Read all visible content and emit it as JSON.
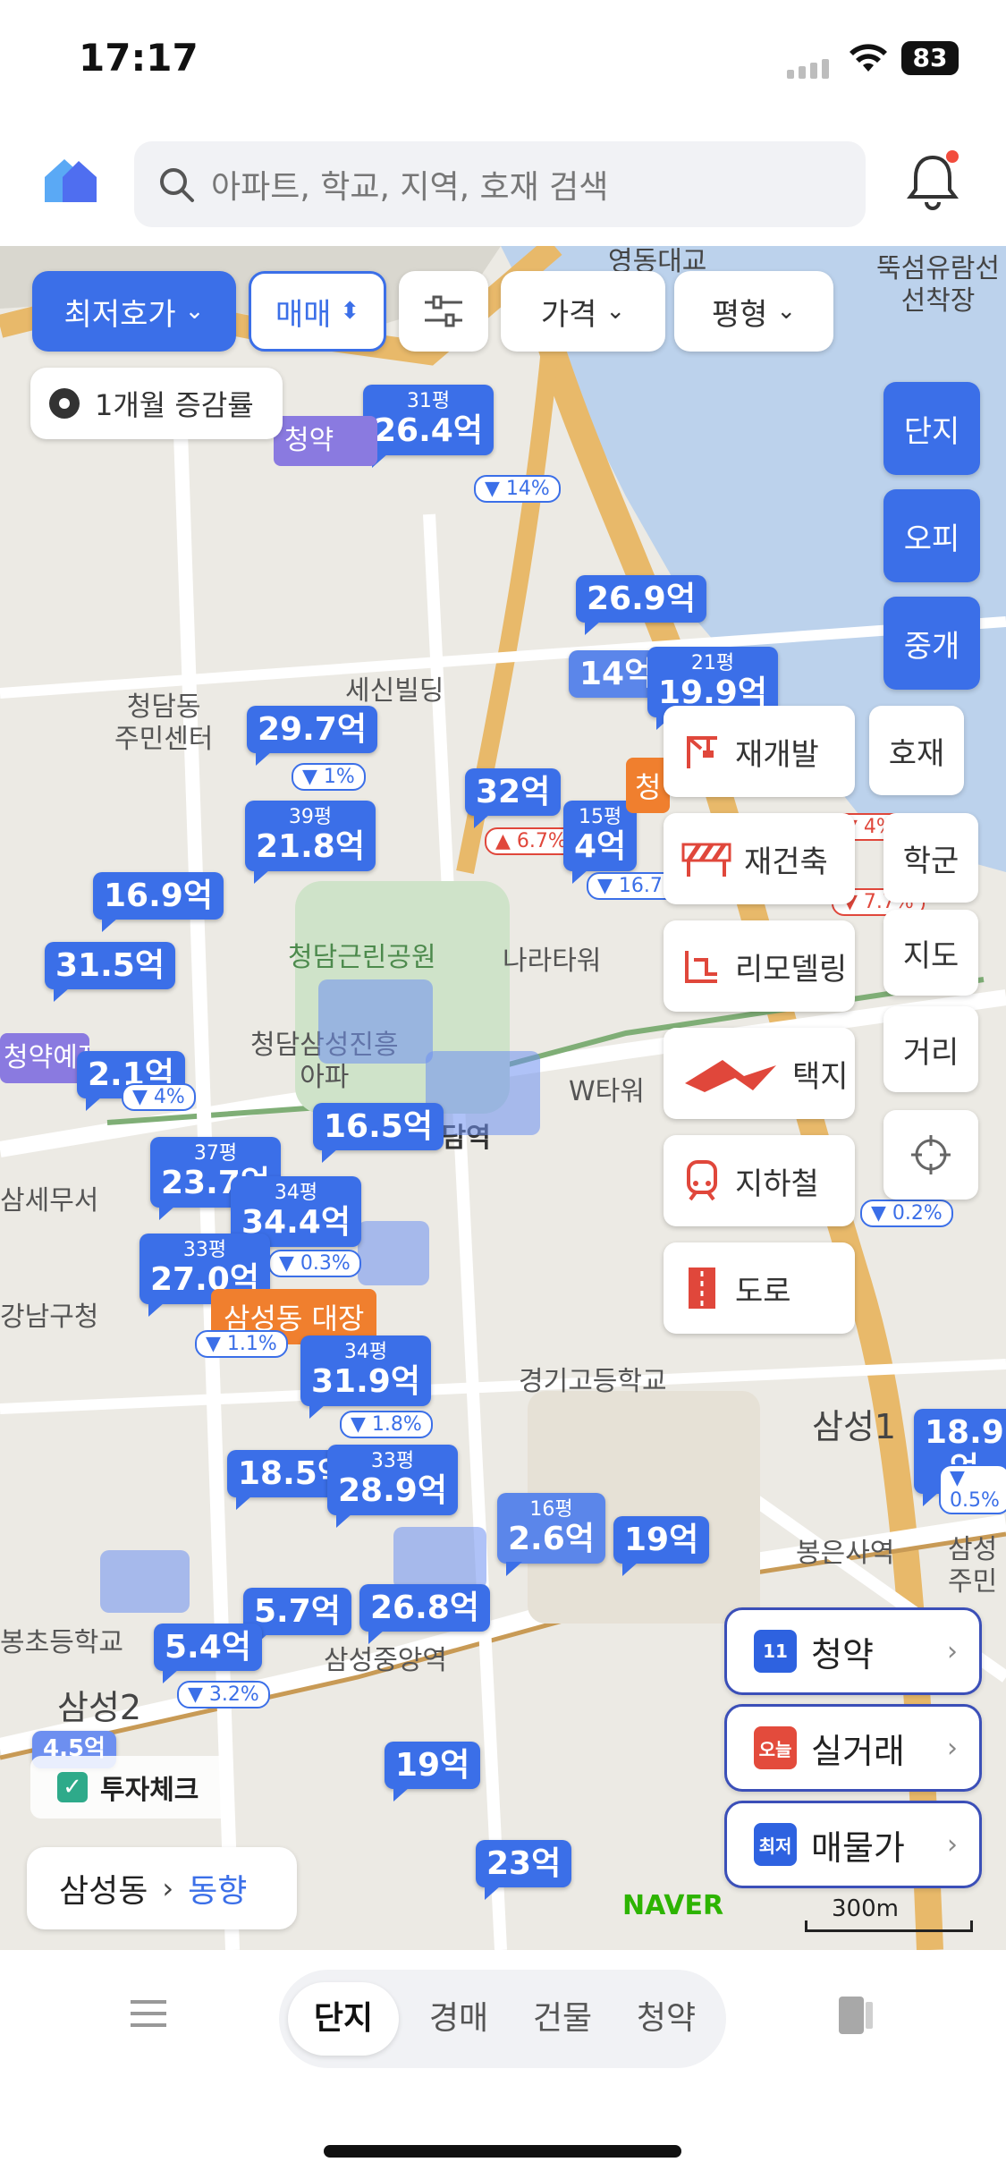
{
  "status": {
    "time": "17:17",
    "battery": "83"
  },
  "header": {
    "search_placeholder": "아파트, 학교, 지역, 호재 검색"
  },
  "filters": [
    {
      "label": "최저호가"
    },
    {
      "label": "매매"
    },
    {
      "label": ""
    },
    {
      "label": "가격"
    },
    {
      "label": "평형"
    }
  ],
  "growth_toggle": "1개월 증감률",
  "side_tabs": [
    "단지",
    "오피",
    "중개"
  ],
  "layers": [
    {
      "label": "재개발",
      "icon": "crane-icon"
    },
    {
      "label": "재건축",
      "icon": "barrier-icon"
    },
    {
      "label": "리모델링",
      "icon": "remodel-icon"
    },
    {
      "label": "택지",
      "icon": "land-icon"
    },
    {
      "label": "지하철",
      "icon": "subway-icon"
    },
    {
      "label": "도로",
      "icon": "road-icon"
    }
  ],
  "side_buttons": [
    "호재",
    "학군",
    "지도",
    "거리"
  ],
  "quick_buttons": [
    {
      "label": "청약",
      "icon_text": "11",
      "color": "#2e62e0"
    },
    {
      "label": "실거래",
      "icon_text": "오늘",
      "color": "#e34b3c"
    },
    {
      "label": "매물가",
      "icon_text": "최저",
      "color": "#2e62e0"
    }
  ],
  "invest_check": "투자체크",
  "breadcrumb": {
    "region": "삼성동",
    "link": "동향"
  },
  "map_labels": {
    "yeongdong": "영동대교",
    "ttukseom": "뚝섬유람선\n선착장",
    "cheongdam_center": "청담동\n주민센터",
    "sesin": "세신빌딩",
    "park": "청담근린공원",
    "narai": "나라타워",
    "station": "청담역",
    "w_tower": "W타워",
    "samsung_apt": "청담삼성진흥\n아파",
    "samse": "삼세무서",
    "gangnam_gu": "강남구청",
    "kyunggi": "경기고등학교",
    "samsung1": "삼성1",
    "bongeunsa": "봉은사역",
    "samsungjumin": "삼성\n주민",
    "samsungjungang": "삼성중앙역",
    "school": "봉초등학교",
    "samsung2": "삼성2",
    "naver": "NAVER",
    "scale": "300m"
  },
  "markers": [
    {
      "size": "31평",
      "price": "26.4억"
    },
    {
      "size": "",
      "price": "29.7억",
      "rate": "1%"
    },
    {
      "size": "39평",
      "price": "21.8억"
    },
    {
      "size": "",
      "price": "32억",
      "rate": "6.7%"
    },
    {
      "size": "15평",
      "price": "4억",
      "rate": "16.7%"
    },
    {
      "size": "",
      "price": "26.9억"
    },
    {
      "size": "21평",
      "price": "19.9억"
    },
    {
      "size": "",
      "price": "16.9억"
    },
    {
      "size": "",
      "price": "31.5억"
    },
    {
      "size": "",
      "price": "2.1억"
    },
    {
      "size": "",
      "price": "16.5억"
    },
    {
      "size": "37평",
      "price": "23.7억"
    },
    {
      "size": "34평",
      "price": "34.4억",
      "rate": "0.3%"
    },
    {
      "size": "33평",
      "price": "27.0억"
    },
    {
      "size": "34평",
      "price": "31.9억",
      "rate": "1.8%"
    },
    {
      "size": "",
      "price": "18.5억"
    },
    {
      "size": "33평",
      "price": "28.9억"
    },
    {
      "size": "16평",
      "price": "2.6억"
    },
    {
      "size": "",
      "price": "19억"
    },
    {
      "size": "",
      "price": "5.7억"
    },
    {
      "size": "",
      "price": "5.4억",
      "rate": "3.2%"
    },
    {
      "size": "",
      "price": "26.8억"
    },
    {
      "size": "",
      "price": "19억"
    },
    {
      "size": "",
      "price": "23억"
    },
    {
      "size": "",
      "price": "18.9억",
      "rate": "0.5%"
    },
    {
      "size": "",
      "price": "4.5억"
    },
    {
      "size": "",
      "price": "14억"
    }
  ],
  "misc": {
    "rate_14": "14%",
    "cheongyak": "청약예정",
    "samsung_big": "삼성동 대장",
    "rate_1_1": "1.1%",
    "rate_4": "4%",
    "rate_77": "7.7%",
    "rate_02": "0.2%",
    "rate_right4": "4%"
  },
  "bottom_tabs": [
    "단지",
    "경매",
    "건물",
    "청약"
  ],
  "colors": {
    "accent": "#3b6fe8",
    "orange": "#f07f2e",
    "danger": "#e0473b"
  }
}
